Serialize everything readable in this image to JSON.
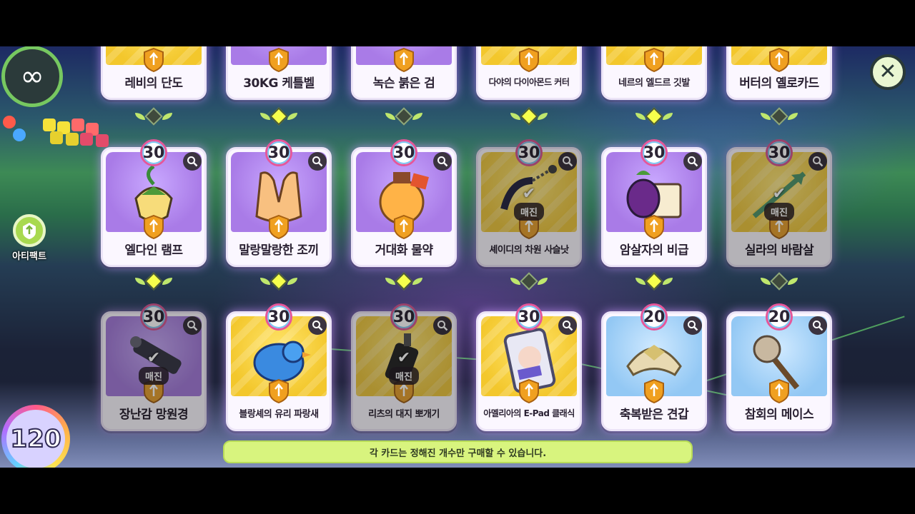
{
  "shop": {
    "notice": "각 카드는 정해진 개수만 구매할 수 있습니다.",
    "artifact_label": "아티팩트",
    "counter_value": "120"
  },
  "rows": [
    {
      "cards": [
        {
          "name": "레비의 단도",
          "bg": "yellow",
          "sold": false,
          "gem_active": false
        },
        {
          "name": "30KG 케틀벨",
          "bg": "purple",
          "sold": false,
          "gem_active": true
        },
        {
          "name": "녹슨 붉은 검",
          "bg": "purple",
          "sold": false,
          "gem_active": false
        },
        {
          "name": "다야의 다이아몬드 커터",
          "bg": "yellow",
          "sold": false,
          "gem_active": true
        },
        {
          "name": "네르의 엘드르 깃발",
          "bg": "yellow",
          "sold": false,
          "gem_active": true
        },
        {
          "name": "버터의 옐로카드",
          "bg": "yellow",
          "sold": false,
          "gem_active": false
        }
      ]
    },
    {
      "cards": [
        {
          "name": "엘다인 램프",
          "level": "30",
          "bg": "purple",
          "sold": false,
          "icon": "flower-lamp-icon",
          "gem_active": true
        },
        {
          "name": "말랑말랑한 조끼",
          "level": "30",
          "bg": "purple",
          "sold": false,
          "icon": "vest-icon",
          "gem_active": true
        },
        {
          "name": "거대화 물약",
          "level": "30",
          "bg": "purple",
          "sold": false,
          "icon": "potion-icon",
          "gem_active": true
        },
        {
          "name": "셰이디의 차원 사슬낫",
          "level": "30",
          "bg": "yellow",
          "sold": true,
          "sold_label": "매진",
          "icon": "chain-sickle-icon",
          "gem_active": false
        },
        {
          "name": "암살자의 비급",
          "level": "30",
          "bg": "purple",
          "sold": false,
          "icon": "secret-book-icon",
          "gem_active": true
        },
        {
          "name": "실라의 바람살",
          "level": "30",
          "bg": "yellow",
          "sold": true,
          "sold_label": "매진",
          "icon": "wind-arrow-icon",
          "gem_active": false
        }
      ]
    },
    {
      "cards": [
        {
          "name": "장난감 망원경",
          "level": "30",
          "bg": "purple",
          "sold": true,
          "sold_label": "매진",
          "icon": "telescope-icon"
        },
        {
          "name": "블랑셰의 유리 파랑새",
          "level": "30",
          "bg": "yellow",
          "sold": false,
          "icon": "glass-bluebird-icon"
        },
        {
          "name": "리츠의 대지 뽀개기",
          "level": "30",
          "bg": "yellow",
          "sold": true,
          "sold_label": "매진",
          "icon": "earth-breaker-icon"
        },
        {
          "name": "아멜리아의 E-Pad 클래식",
          "level": "30",
          "bg": "yellow",
          "sold": false,
          "icon": "tablet-icon"
        },
        {
          "name": "축복받은 견갑",
          "level": "20",
          "bg": "blue",
          "sold": false,
          "icon": "pauldron-icon"
        },
        {
          "name": "참회의 메이스",
          "level": "20",
          "bg": "blue",
          "sold": false,
          "icon": "mace-icon"
        }
      ]
    }
  ],
  "colors": {
    "gem_active": "#f6ff4c",
    "notice_bg": "#d8f47e",
    "accent_green": "#77c860"
  }
}
